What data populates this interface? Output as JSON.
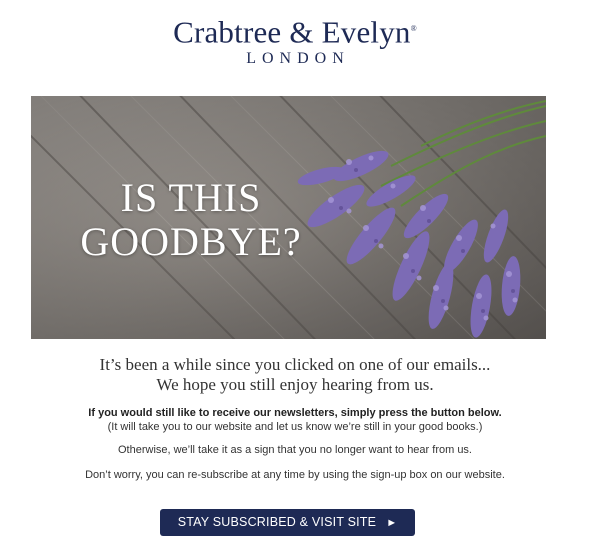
{
  "header": {
    "brand_name": "Crabtree & Evelyn",
    "brand_mark": "®",
    "brand_city": "LONDON"
  },
  "hero": {
    "headline_line1": "IS THIS",
    "headline_line2": "GOODBYE?"
  },
  "intro": {
    "line1": "It’s been a while since you clicked on one of our emails...",
    "line2": "We hope you still enjoy hearing from us."
  },
  "body": {
    "newsletter_bold": "If you would still like to receive our newsletters, simply press the button below.",
    "newsletter_note": "(It will take you to our website and let us know we’re still in your good books.)",
    "otherwise": "Otherwise, we’ll take it as a sign that you no longer want to hear from us.",
    "resubscribe": "Don’t worry, you can re-subscribe at any time by using the sign-up box on our website."
  },
  "cta": {
    "label": "STAY SUBSCRIBED & VISIT SITE",
    "arrow": "►"
  },
  "colors": {
    "brand_navy": "#1e2a55",
    "lavender": "#8b78c4",
    "wood": "#8a8580"
  },
  "icons": {
    "cta_arrow": "play-arrow-icon"
  }
}
